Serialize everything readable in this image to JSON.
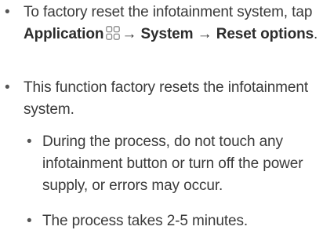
{
  "bullet_char": "•",
  "arrow": "→",
  "items": [
    {
      "pre": "To factory reset the infotainment system, tap ",
      "app_label": "Application",
      "system_label": "System",
      "reset_label": "Reset options",
      "end": "."
    },
    {
      "text": "This function factory resets the infotainment system."
    }
  ],
  "subitems": [
    {
      "text": "During the process, do not touch any infotainment button or turn off the power supply, or errors may occur."
    },
    {
      "text": "The process takes 2-5 minutes."
    }
  ],
  "icons": {
    "application": "grid-apps-icon"
  }
}
